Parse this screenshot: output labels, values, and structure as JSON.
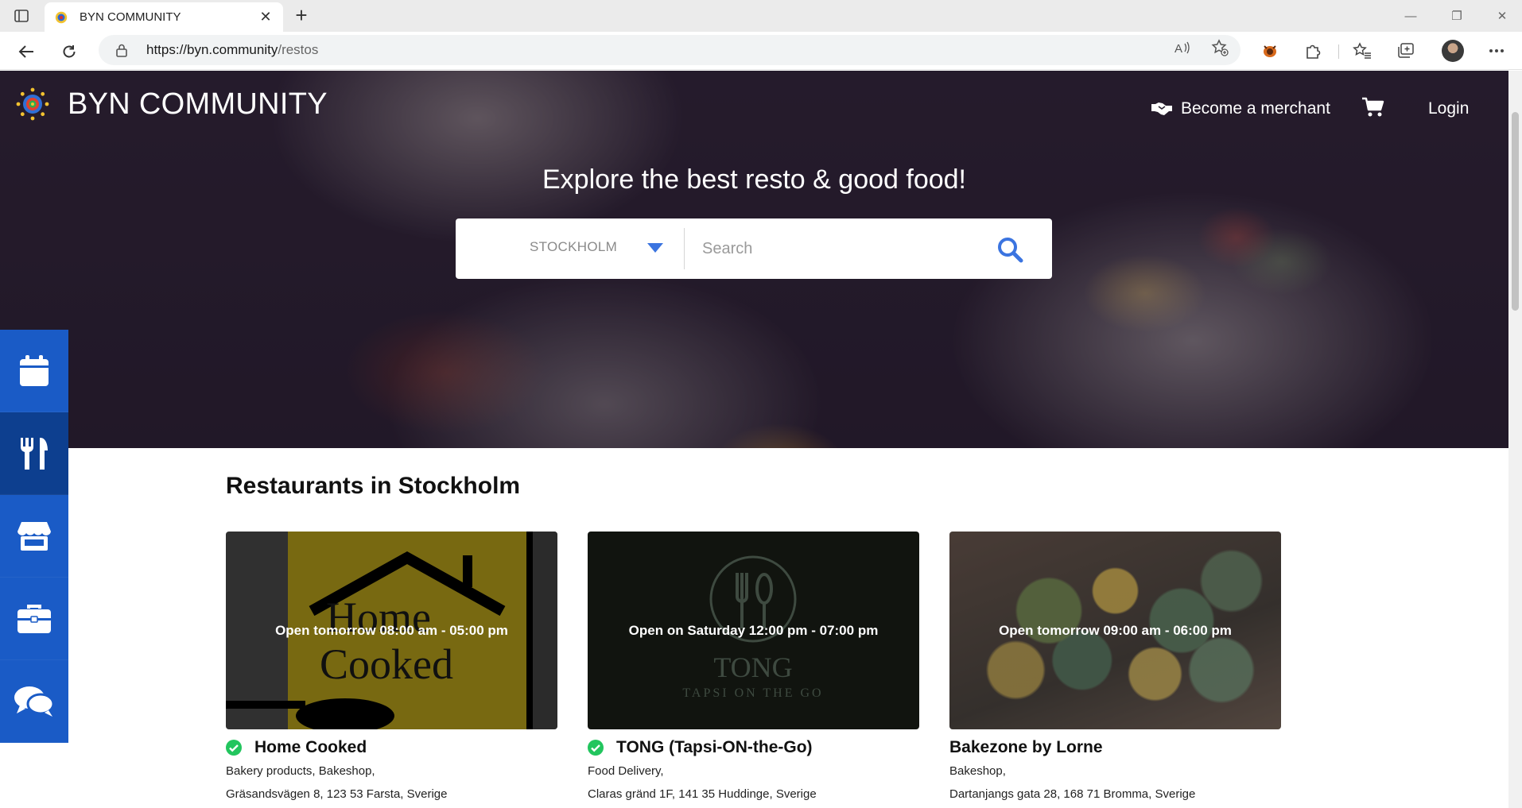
{
  "browser": {
    "tab_title": "BYN COMMUNITY",
    "tab_close": "✕",
    "new_tab": "+",
    "url_host": "https://byn.community",
    "url_path": "/restos",
    "window_minimize": "—",
    "window_restore": "❐",
    "window_close": "✕"
  },
  "header": {
    "brand": "BYN COMMUNITY",
    "become_merchant": "Become a merchant",
    "login": "Login"
  },
  "hero": {
    "title": "Explore the best resto & good food!",
    "city": "STOCKHOLM",
    "search_placeholder": "Search"
  },
  "sidedock": {
    "items": [
      {
        "icon": "calendar-icon",
        "active": false
      },
      {
        "icon": "utensils-icon",
        "active": true
      },
      {
        "icon": "store-icon",
        "active": false
      },
      {
        "icon": "briefcase-icon",
        "active": false
      },
      {
        "icon": "chat-icon",
        "active": false
      }
    ]
  },
  "main": {
    "section_title": "Restaurants in Stockholm",
    "restaurants": [
      {
        "name": "Home Cooked",
        "hours": "Open tomorrow 08:00 am - 05:00 pm",
        "categories": "Bakery products, Bakeshop,",
        "address": "Gräsandsvägen 8, 123 53 Farsta, Sverige",
        "verified": true,
        "image_text": [
          "Home",
          "Cooked"
        ]
      },
      {
        "name": "TONG (Tapsi-ON-the-Go)",
        "hours": "Open on Saturday 12:00 pm - 07:00 pm",
        "categories": "Food Delivery,",
        "address": "Claras gränd 1F, 141 35 Huddinge, Sverige",
        "verified": true,
        "image_text": [
          "TONG",
          "TAPSI ON THE GO"
        ]
      },
      {
        "name": "Bakezone by Lorne",
        "hours": "Open tomorrow 09:00 am - 06:00 pm",
        "categories": "Bakeshop,",
        "address": "Dartanjangs gata 28, 168 71 Bromma, Sverige",
        "verified": false
      }
    ]
  },
  "colors": {
    "dock_blue": "#1a5bc6",
    "dock_active": "#0d3f8f",
    "search_icon_blue": "#3b74e0",
    "verified_green": "#22c55e"
  }
}
